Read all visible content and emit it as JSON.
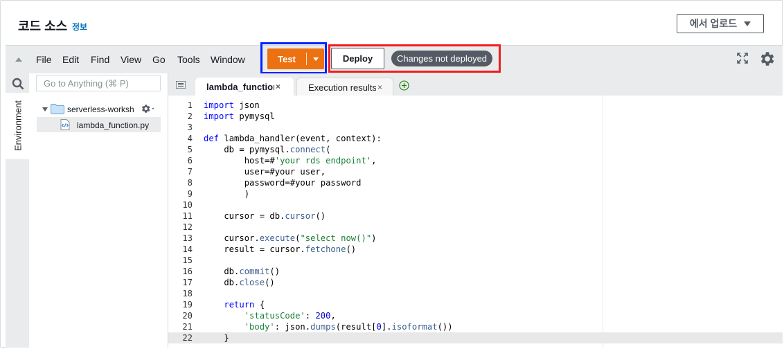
{
  "header": {
    "title": "코드 소스",
    "info_link": "정보",
    "upload_button": "에서 업로드"
  },
  "menubar": {
    "items": [
      "File",
      "Edit",
      "Find",
      "View",
      "Go",
      "Tools",
      "Window"
    ],
    "test_button": "Test",
    "deploy_button": "Deploy",
    "status_badge": "Changes not deployed",
    "highlight_colors": {
      "test": "#0022ff",
      "deploy": "#f21d1d"
    },
    "accent_color": "#ec7211"
  },
  "sidebar": {
    "search_placeholder": "Go to Anything (⌘ P)",
    "environment_tab": "Environment",
    "folder": "serverless-workshop",
    "file": "lambda_function.py"
  },
  "tabs": [
    {
      "label": "lambda_function",
      "close": "×",
      "active": true
    },
    {
      "label": "Execution results",
      "close": "×",
      "active": false
    }
  ],
  "editor": {
    "active_line": 22,
    "lines": [
      "import json",
      "import pymysql",
      "",
      "def lambda_handler(event, context):",
      "    db = pymysql.connect(",
      "        host=#'your rds endpoint',",
      "        user=#your user,",
      "        password=#your password",
      "        )",
      "",
      "    cursor = db.cursor()",
      "",
      "    cursor.execute(\"select now()\")",
      "    result = cursor.fetchone()",
      "",
      "    db.commit()",
      "    db.close()",
      "",
      "    return {",
      "        'statusCode': 200,",
      "        'body': json.dumps(result[0].isoformat())",
      "    }"
    ]
  }
}
